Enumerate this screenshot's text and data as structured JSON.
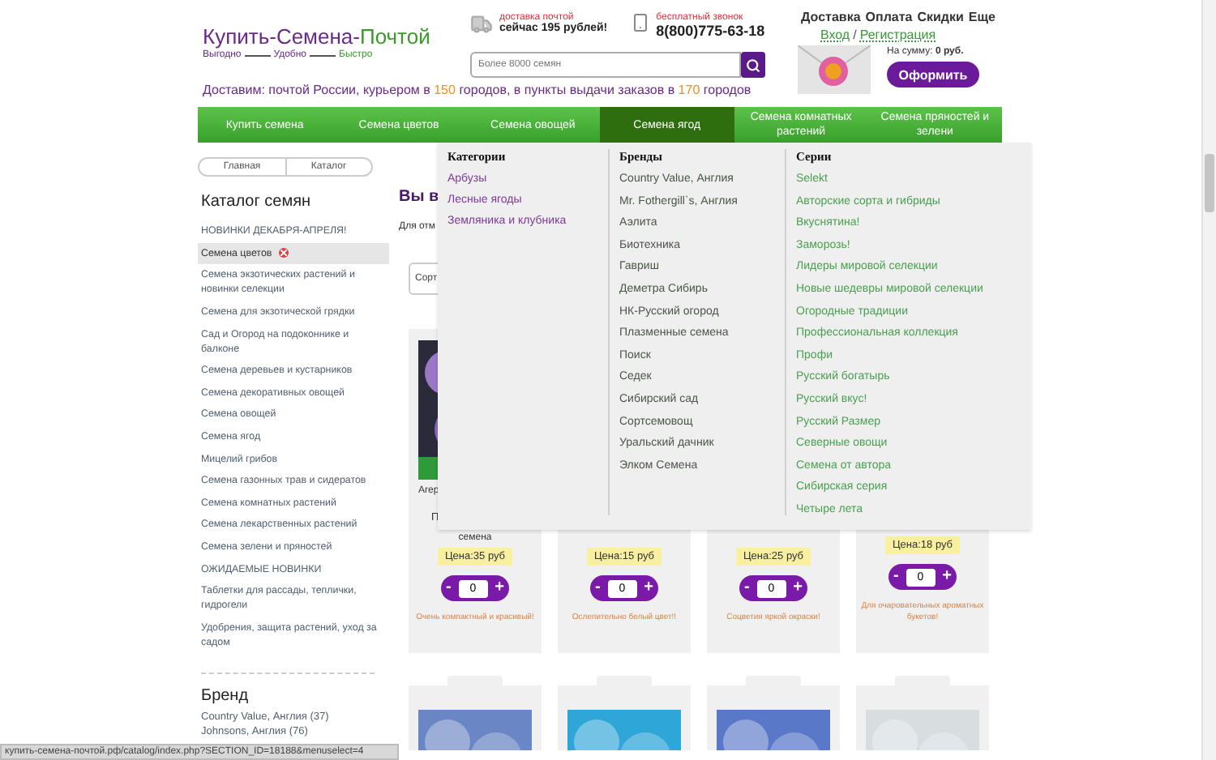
{
  "header": {
    "logo": {
      "title_parts": [
        "Купить",
        "-Семена-",
        "Почтой"
      ],
      "slogan": [
        "Выгодно",
        "Удобно",
        "Быстро"
      ]
    },
    "delivery_info": {
      "label": "доставка почтой",
      "value": "сейчас 195 рублей!"
    },
    "phone_info": {
      "label": "бесплатный звонок",
      "value": "8(800)775-63-18"
    },
    "search": {
      "placeholder": "Более 8000 семян"
    },
    "top_links": [
      "Доставка",
      "Оплата",
      "Скидки",
      "Еще"
    ],
    "auth": {
      "login": "Вход",
      "separator": "/",
      "register": "Регистрация"
    },
    "cart": {
      "sum_label": "На сумму:",
      "sum_value": "0 руб.",
      "checkout_button": "Оформить"
    },
    "delivery_line": [
      {
        "text": "Доставим: почтой России, курьером в ",
        "highlight": false
      },
      {
        "text": "150",
        "highlight": true
      },
      {
        "text": " городов, в пункты выдачи заказов в ",
        "highlight": false
      },
      {
        "text": "170",
        "highlight": true
      },
      {
        "text": " городов",
        "highlight": false
      }
    ]
  },
  "nav": {
    "items": [
      {
        "label": "Купить семена",
        "selected": false
      },
      {
        "label": "Семена цветов",
        "selected": false
      },
      {
        "label": "Семена овощей",
        "selected": false
      },
      {
        "label": "Семена ягод",
        "selected": true
      },
      {
        "label": "Семена комнатных растений",
        "selected": false
      },
      {
        "label": "Семена пряностей и зелени",
        "selected": false
      }
    ]
  },
  "mega_menu": {
    "columns": [
      {
        "kind": "categories",
        "heading": "Категории",
        "items": [
          "Арбузы",
          "Лесные ягоды",
          "Земляника и клубника"
        ]
      },
      {
        "kind": "brands",
        "heading": "Бренды",
        "items": [
          "Country Value, Англия",
          "Mr. Fothergill`s, Англия",
          "Аэлита",
          "Биотехника",
          "Гавриш",
          "Деметра Сибирь",
          "НК-Русский огород",
          "Плазменные семена",
          "Поиск",
          "Седек",
          "Сибирский сад",
          "Сортсемовощ",
          "Уральский дачник",
          "Элком Семена"
        ]
      },
      {
        "kind": "series",
        "heading": "Серии",
        "items": [
          "Selekt",
          "Авторские сорта и гибриды",
          "Вкуснятина!",
          "Заморозь!",
          "Лидеры мировой селекции",
          "Новые шедевры мировой селекции",
          "Огородные традиции",
          "Профессиональная коллекция",
          "Профи",
          "Русский богатырь",
          "Русский вкус!",
          "Русский Размер",
          "Северные овощи",
          "Семена от автора",
          "Сибирская серия",
          "Четыре лета"
        ]
      }
    ]
  },
  "breadcrumbs": [
    "Главная",
    "Каталог"
  ],
  "sidebar": {
    "title": "Каталог семян",
    "items": [
      {
        "label": "НОВИНКИ ДЕКАБРЯ-АПРЕЛЯ!",
        "selected": false
      },
      {
        "label": "Семена цветов",
        "selected": true
      },
      {
        "label": "Семена экзотических растений и новинки селекции",
        "selected": false
      },
      {
        "label": "Семена для экзотической грядки",
        "selected": false
      },
      {
        "label": "Сад и Огород на подоконнике и балконе",
        "selected": false
      },
      {
        "label": "Семена деревьев и кустарников",
        "selected": false
      },
      {
        "label": "Семена декоративных овощей",
        "selected": false
      },
      {
        "label": "Семена овощей",
        "selected": false
      },
      {
        "label": "Семена ягод",
        "selected": false
      },
      {
        "label": "Мицелий грибов",
        "selected": false
      },
      {
        "label": "Семена газонных трав и сидератов",
        "selected": false
      },
      {
        "label": "Семена комнатных растений",
        "selected": false
      },
      {
        "label": "Семена лекарственных растений",
        "selected": false
      },
      {
        "label": "Семена зелени и пряностей",
        "selected": false
      },
      {
        "label": "ОЖИДАЕМЫЕ НОВИНКИ",
        "selected": false
      },
      {
        "label": "Таблетки для рассады, теплички, гидрогели",
        "selected": false
      },
      {
        "label": "Удобрения, защита растений, уход за садом",
        "selected": false
      }
    ],
    "brand_title": "Бренд",
    "brands": [
      "Country Value, Англия (37)",
      "Johnsons, Англия (76)"
    ]
  },
  "main": {
    "title": "Вы в",
    "note": "Для отм",
    "sort": "Сорт",
    "cards": [
      {
        "name": "Агер",
        "line": "П",
        "subtitle": "семена",
        "price": "Цена:35 руб",
        "quantity": "0",
        "minus": "-",
        "plus": "+",
        "description": "Очень компактный и красивый!"
      },
      {
        "price": "Цена:15 руб",
        "quantity": "0",
        "minus": "-",
        "plus": "+",
        "description": "Ослепительно белый цвет!!"
      },
      {
        "price": "Цена:25 руб",
        "quantity": "0",
        "minus": "-",
        "plus": "+",
        "description": "Соцветия яркой окраски!"
      },
      {
        "price": "Цена:18 руб",
        "quantity": "0",
        "minus": "-",
        "plus": "+",
        "description": "Для очаровательных ароматных букетов!"
      }
    ]
  },
  "status_bar": {
    "url": "купить-семена-почтой.рф/catalog/index.php?SECTION_ID=18188&menuselect=4"
  }
}
